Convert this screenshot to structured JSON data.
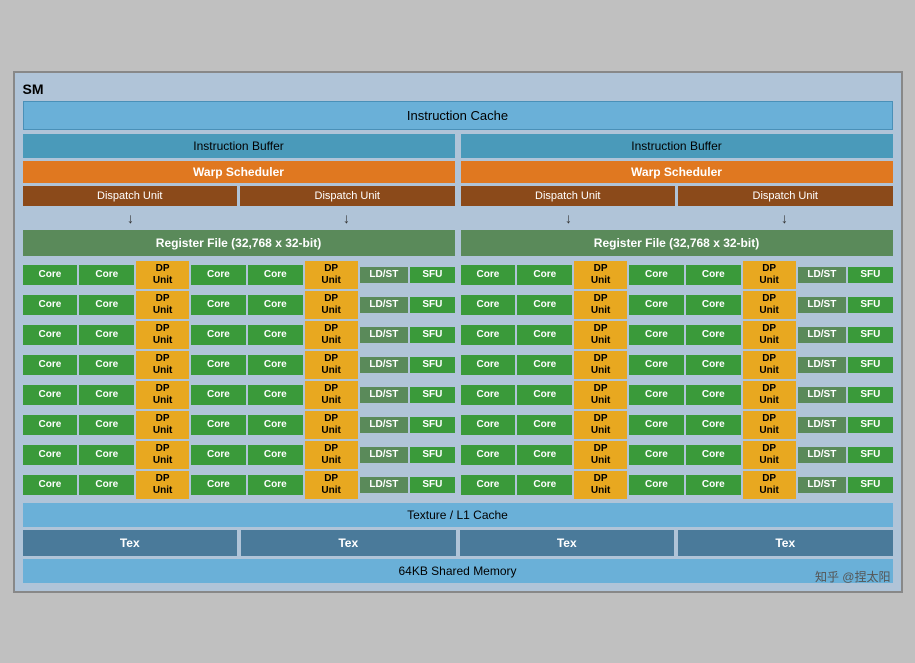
{
  "title": "SM",
  "instructionCache": "Instruction Cache",
  "left": {
    "instrBuffer": "Instruction Buffer",
    "warpScheduler": "Warp Scheduler",
    "dispatch1": "Dispatch Unit",
    "dispatch2": "Dispatch Unit",
    "registerFile": "Register File (32,768 x 32-bit)"
  },
  "right": {
    "instrBuffer": "Instruction Buffer",
    "warpScheduler": "Warp Scheduler",
    "dispatch1": "Dispatch Unit",
    "dispatch2": "Dispatch Unit",
    "registerFile": "Register File (32,768 x 32-bit)"
  },
  "coreLabel": "Core",
  "dpLabel": "DP\nUnit",
  "ldstLabel": "LD/ST",
  "sfuLabel": "SFU",
  "rows": 8,
  "textureCache": "Texture / L1 Cache",
  "texLabels": [
    "Tex",
    "Tex",
    "Tex",
    "Tex"
  ],
  "sharedMemory": "64KB Shared Memory",
  "watermark": "知乎 @捏太阳"
}
